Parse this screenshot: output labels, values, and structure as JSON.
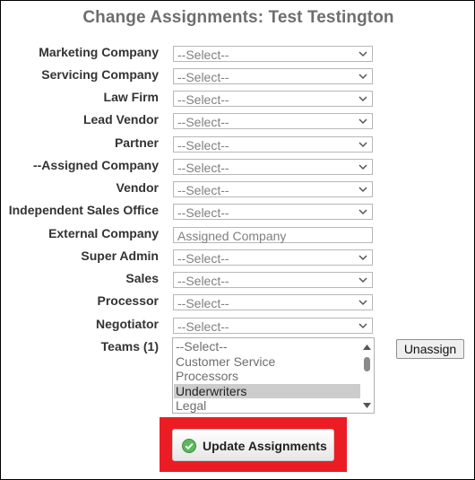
{
  "page": {
    "title": "Change Assignments: Test Testington"
  },
  "fields": [
    {
      "label": "Marketing Company",
      "value": "--Select--"
    },
    {
      "label": "Servicing Company",
      "value": "--Select--"
    },
    {
      "label": "Law Firm",
      "value": "--Select--"
    },
    {
      "label": "Lead Vendor",
      "value": "--Select--"
    },
    {
      "label": "Partner",
      "value": "--Select--"
    },
    {
      "label": "--Assigned Company",
      "value": "--Select--"
    },
    {
      "label": "Vendor",
      "value": "--Select--"
    },
    {
      "label": "Independent Sales Office",
      "value": "--Select--"
    },
    {
      "label": "External Company",
      "value": "Assigned Company"
    },
    {
      "label": "Super Admin",
      "value": "--Select--"
    },
    {
      "label": "Sales",
      "value": "--Select--"
    },
    {
      "label": "Processor",
      "value": "--Select--"
    },
    {
      "label": "Negotiator",
      "value": "--Select--"
    }
  ],
  "teams": {
    "label": "Teams (1)",
    "options": [
      "--Select--",
      "Customer Service",
      "Processors",
      "Underwriters",
      "Legal"
    ],
    "selected": "Underwriters",
    "unassign_label": "Unassign"
  },
  "update_button": {
    "label": "Update Assignments",
    "icon": "check-circle-icon",
    "icon_color": "#5cb85c",
    "highlight_color": "#ec1c24"
  }
}
